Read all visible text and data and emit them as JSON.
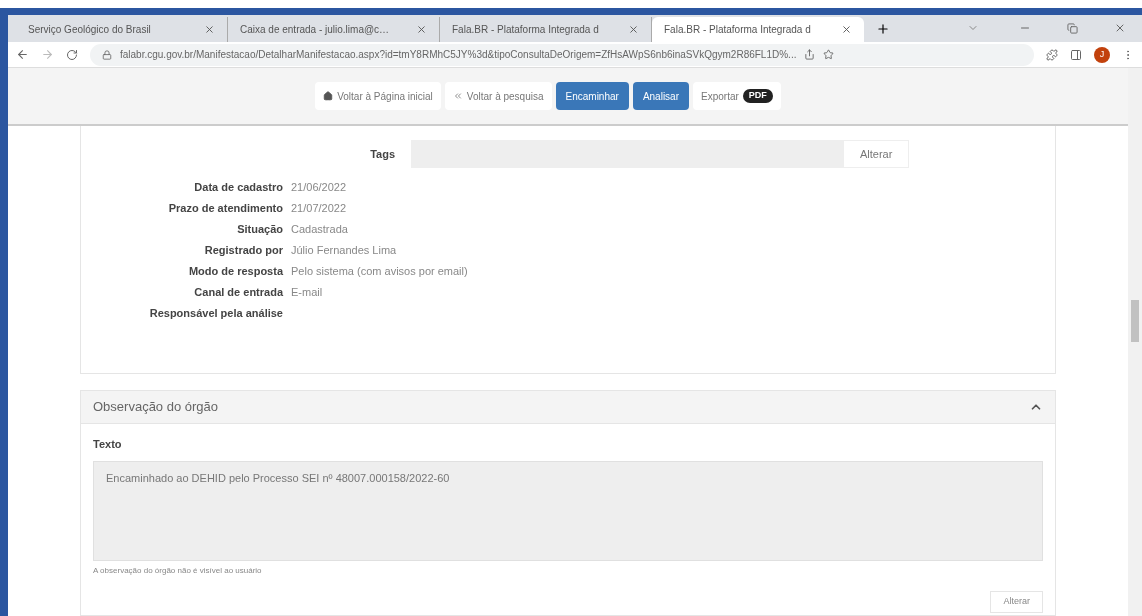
{
  "browser": {
    "tabs": [
      {
        "title": "Serviço Geológico do Brasil",
        "selected": false
      },
      {
        "title": "Caixa de entrada - julio.lima@c…",
        "selected": false
      },
      {
        "title": "Fala.BR - Plataforma Integrada d",
        "selected": false
      },
      {
        "title": "Fala.BR - Plataforma Integrada d",
        "selected": true
      }
    ],
    "url": "falabr.cgu.gov.br/Manifestacao/DetalharManifestacao.aspx?id=tmY8RMhC5JY%3d&tipoConsultaDeOrigem=ZfHsAWpS6nb6inaSVkQgym2R86FL1D%...",
    "avatar": "J"
  },
  "toolbar": [
    {
      "kind": "home",
      "label": "Voltar à Página inicial"
    },
    {
      "kind": "back",
      "label": "Voltar à pesquisa"
    },
    {
      "kind": "primary",
      "label": "Encaminhar"
    },
    {
      "kind": "primary",
      "label": "Analisar"
    },
    {
      "kind": "export",
      "label": "Exportar",
      "badge": "PDF"
    }
  ],
  "tags": {
    "label": "Tags",
    "button": "Alterar"
  },
  "details": [
    {
      "label": "Data de cadastro",
      "value": "21/06/2022"
    },
    {
      "label": "Prazo de atendimento",
      "value": "21/07/2022"
    },
    {
      "label": "Situação",
      "value": "Cadastrada"
    },
    {
      "label": "Registrado por",
      "value": "Júlio Fernandes Lima"
    },
    {
      "label": "Modo de resposta",
      "value": "Pelo sistema (com avisos por email)"
    },
    {
      "label": "Canal de entrada",
      "value": "E-mail"
    },
    {
      "label": "Responsável pela análise"
    }
  ],
  "observation": {
    "title": "Observação do órgão",
    "expanded": true,
    "field_label": "Texto",
    "text": "Encaminhado ao DEHID pelo Processo SEI nº 48007.000158/2022-60",
    "hint": "A observação do órgão não é visível ao usuário",
    "button": "Alterar"
  }
}
